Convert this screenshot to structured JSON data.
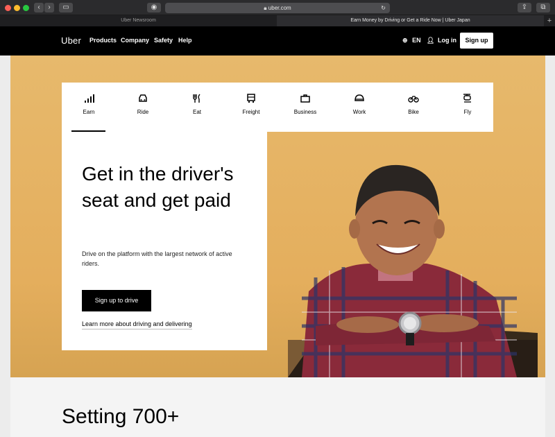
{
  "browser": {
    "address": "uber.com",
    "tabs": [
      "Uber Newsroom",
      "Earn Money by Driving or Get a Ride Now | Uber Japan"
    ]
  },
  "header": {
    "logo": "Uber",
    "nav": [
      "Products",
      "Company",
      "Safety",
      "Help"
    ],
    "lang": "EN",
    "login": "Log in",
    "signup": "Sign up"
  },
  "services": [
    {
      "label": "Earn",
      "icon": "bars-icon"
    },
    {
      "label": "Ride",
      "icon": "car-icon"
    },
    {
      "label": "Eat",
      "icon": "utensils-icon"
    },
    {
      "label": "Freight",
      "icon": "truck-icon"
    },
    {
      "label": "Business",
      "icon": "briefcase-icon"
    },
    {
      "label": "Work",
      "icon": "helmet-icon"
    },
    {
      "label": "Bike",
      "icon": "bike-icon"
    },
    {
      "label": "Fly",
      "icon": "helicopter-icon"
    }
  ],
  "hero": {
    "title": "Get in the driver's seat and get paid",
    "description": "Drive on the platform with the largest network of active riders.",
    "cta": "Sign up to drive",
    "link": "Learn more about driving and delivering"
  },
  "section": {
    "title": "Setting 700+"
  }
}
